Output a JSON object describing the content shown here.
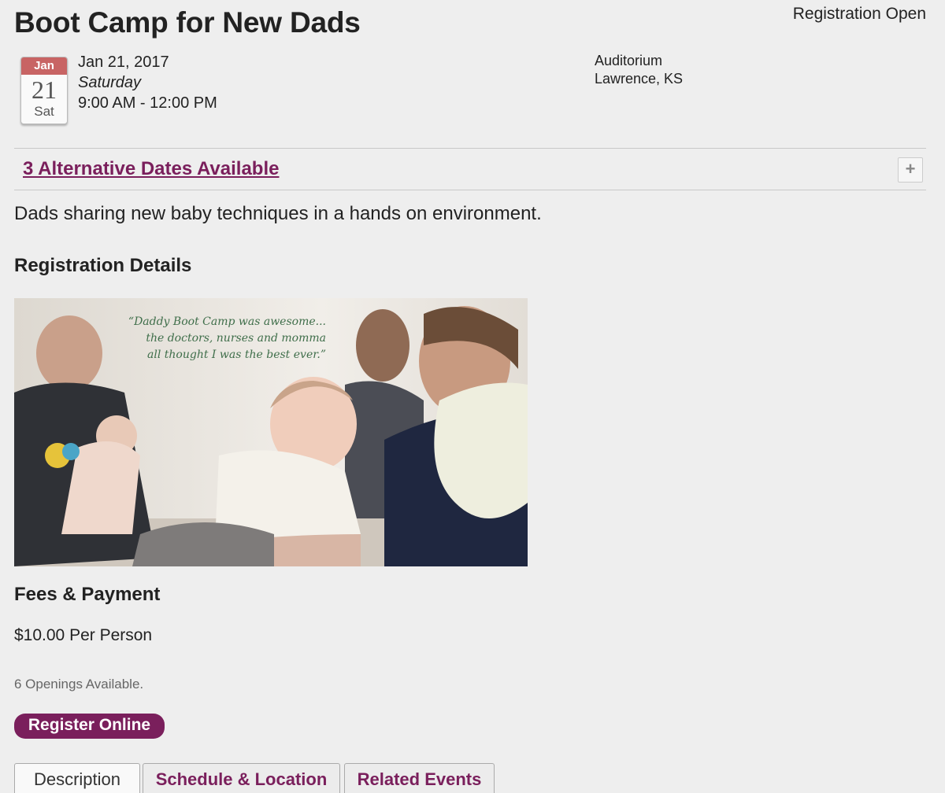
{
  "event": {
    "title": "Boot Camp for New Dads",
    "status": "Registration Open",
    "calendar": {
      "month": "Jan",
      "day": "21",
      "weekday": "Sat"
    },
    "date": "Jan 21, 2017",
    "weekday_full": "Saturday",
    "time": "9:00 AM - 12:00 PM",
    "location": {
      "venue": "Auditorium",
      "city": "Lawrence, KS"
    },
    "alternatives_link": "3 Alternative Dates Available",
    "expand_symbol": "+",
    "description": "Dads sharing new baby techniques in a hands on environment."
  },
  "registration": {
    "heading": "Registration Details",
    "image_quote": [
      "“Daddy Boot Camp was awesome...",
      "the doctors, nurses and momma",
      "all thought I was the best ever.”"
    ]
  },
  "fees": {
    "heading": "Fees & Payment",
    "price": "$10.00 Per Person",
    "openings": "6 Openings Available.",
    "register_label": "Register Online"
  },
  "tabs": [
    {
      "label": "Description",
      "active": true
    },
    {
      "label": "Schedule & Location",
      "active": false
    },
    {
      "label": "Related Events",
      "active": false
    }
  ],
  "colors": {
    "accent": "#7a1f5c",
    "calendar_header": "#c86464",
    "quote_text": "#3f6e4a",
    "background": "#eeeeee"
  }
}
